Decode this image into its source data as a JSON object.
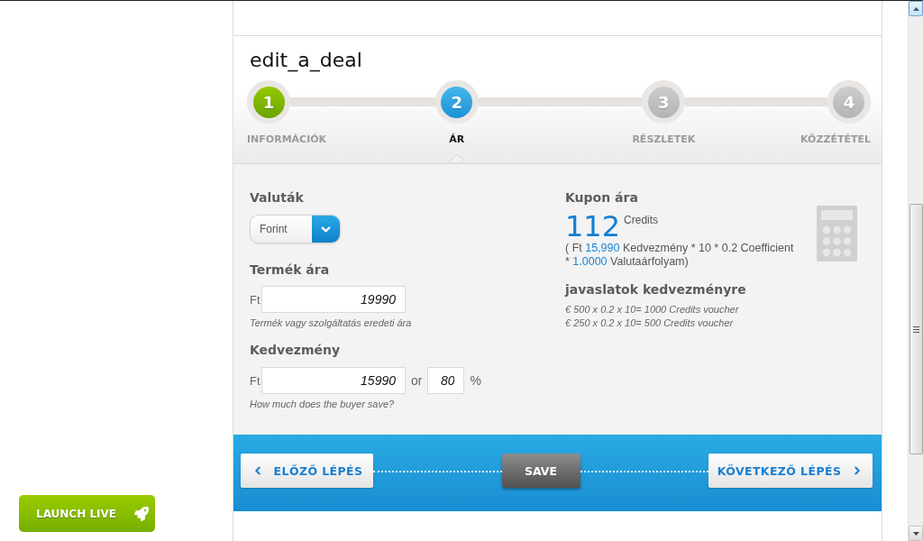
{
  "title": "edit_a_deal",
  "steps": [
    {
      "number": "1",
      "label": "INFORMÁCIÓK",
      "completed": true,
      "selected": false
    },
    {
      "number": "2",
      "label": "ÁR",
      "completed": false,
      "selected": true
    },
    {
      "number": "3",
      "label": "RÉSZLETEK",
      "completed": false,
      "selected": false
    },
    {
      "number": "4",
      "label": "KÖZZÉTÉTEL",
      "completed": false,
      "selected": false
    }
  ],
  "currency": {
    "label": "Valuták",
    "value": "Forint"
  },
  "product_price": {
    "label": "Termék ára",
    "unit": "Ft",
    "value": "19990",
    "hint": "Termék vagy szolgáltatás eredeti ára"
  },
  "discount": {
    "label": "Kedvezmény",
    "unit": "Ft",
    "value": "15990",
    "separator": "or",
    "percent_value": "80",
    "percent_sign": "%",
    "hint": "How much does the buyer save?"
  },
  "coupon_price": {
    "label": "Kupon ára",
    "amount": "112",
    "unit": "Credits",
    "formula": [
      {
        "text": "( Ft ",
        "highlight": false
      },
      {
        "text": "15,990",
        "highlight": true
      },
      {
        "text": " Kedvezmény * 10 * 0.2 Coefficient * ",
        "highlight": false
      },
      {
        "text": "1.0000",
        "highlight": true
      },
      {
        "text": " Valutaárfolyam)",
        "highlight": false
      }
    ]
  },
  "suggestions": {
    "title": "javaslatok kedvezményre",
    "lines": [
      "€ 500 x 0.2 x 10= 1000 Credits voucher",
      "€ 250 x 0.2 x 10= 500 Credits voucher"
    ]
  },
  "footer": {
    "previous": "ELŐZŐ LÉPÉS",
    "save": "SAVE",
    "next": "KÖVETKEZŐ LÉPÉS"
  },
  "launch_button": "LAUNCH LIVE"
}
